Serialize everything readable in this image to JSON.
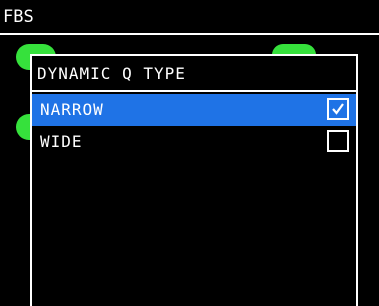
{
  "header": {
    "title": "FBS"
  },
  "dialog": {
    "title": "DYNAMIC Q TYPE",
    "options": [
      {
        "label": "NARROW",
        "checked": true,
        "selected": true
      },
      {
        "label": "WIDE",
        "checked": false,
        "selected": false
      }
    ]
  },
  "colors": {
    "background": "#000000",
    "text": "#ffffff",
    "selection": "#1f73e6",
    "indicator_green": "#36e13c"
  },
  "icons": {
    "checked": "check-mark-icon",
    "unchecked": "empty-checkbox-icon"
  }
}
